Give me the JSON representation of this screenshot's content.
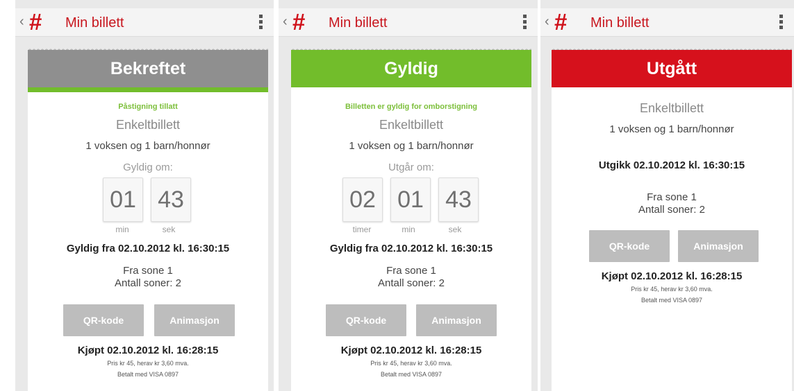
{
  "screens": [
    {
      "back_glyph": "‹",
      "hash_glyph": "#",
      "title": "Min billett",
      "status": "Bekreftet",
      "status_color": "#8f8f8f",
      "status_line_color": "#72bd2b",
      "note": "Påstigning tillatt",
      "ticket_type": "Enkeltbillett",
      "passengers": "1 voksen og 1 barn/honnør",
      "countdown_label": "Gyldig om:",
      "countdown": [
        {
          "value": "01",
          "unit": "min"
        },
        {
          "value": "43",
          "unit": "sek"
        }
      ],
      "validity": "Gyldig fra 02.10.2012 kl. 16:30:15",
      "zone_from": "Fra sone 1",
      "zone_count": "Antall soner: 2",
      "qr_button": "QR-kode",
      "animation_button": "Animasjon",
      "purchased": "Kjøpt 02.10.2012 kl. 16:28:15",
      "price": "Pris kr 45, herav kr 3,60 mva.",
      "paid_with": "Betalt med VISA 0897"
    },
    {
      "back_glyph": "‹",
      "hash_glyph": "#",
      "title": "Min billett",
      "status": "Gyldig",
      "status_color": "#72bd2b",
      "note": "Billetten er gyldig for omborstigning",
      "ticket_type": "Enkeltbillett",
      "passengers": "1 voksen og 1 barn/honnør",
      "countdown_label": "Utgår om:",
      "countdown": [
        {
          "value": "02",
          "unit": "timer"
        },
        {
          "value": "01",
          "unit": "min"
        },
        {
          "value": "43",
          "unit": "sek"
        }
      ],
      "validity": "Gyldig fra 02.10.2012 kl. 16:30:15",
      "zone_from": "Fra sone 1",
      "zone_count": "Antall soner: 2",
      "qr_button": "QR-kode",
      "animation_button": "Animasjon",
      "purchased": "Kjøpt 02.10.2012 kl. 16:28:15",
      "price": "Pris kr 45, herav kr 3,60 mva.",
      "paid_with": "Betalt med VISA 0897"
    },
    {
      "back_glyph": "‹",
      "hash_glyph": "#",
      "title": "Min billett",
      "status": "Utgått",
      "status_color": "#d6111c",
      "ticket_type": "Enkeltbillett",
      "passengers": "1 voksen og 1 barn/honnør",
      "expired": "Utgikk 02.10.2012 kl. 16:30:15",
      "zone_from": "Fra sone 1",
      "zone_count": "Antall soner: 2",
      "qr_button": "QR-kode",
      "animation_button": "Animasjon",
      "purchased": "Kjøpt 02.10.2012 kl. 16:28:15",
      "price": "Pris kr 45, herav kr 3,60 mva.",
      "paid_with": "Betalt med VISA 0897"
    }
  ]
}
